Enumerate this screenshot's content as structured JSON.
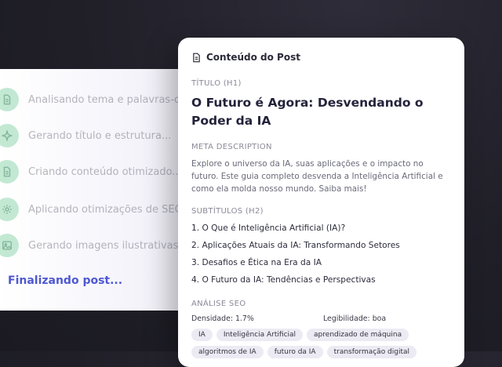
{
  "progress": {
    "steps": [
      {
        "label": "Analisando tema e palavras-chave...",
        "icon": "document-icon"
      },
      {
        "label": "Gerando título e estrutura...",
        "icon": "sparkle-icon"
      },
      {
        "label": "Criando conteúdo otimizado...",
        "icon": "document-icon"
      },
      {
        "label": "Aplicando otimizações de SEO...",
        "icon": "gear-icon"
      },
      {
        "label": "Gerando imagens ilustrativas...",
        "icon": "image-icon"
      }
    ],
    "current": "Finalizando post..."
  },
  "post": {
    "header": "Conteúdo do Post",
    "title_label": "TÍTULO (H1)",
    "title": "O Futuro é Agora: Desvendando o Poder da IA",
    "meta_label": "META DESCRIPTION",
    "meta": "Explore o universo da IA, suas aplicações e o impacto no futuro. Este guia completo desvenda a Inteligência Artificial e como ela molda nosso mundo. Saiba mais!",
    "subtitles_label": "SUBTÍTULOS (H2)",
    "subtitles": [
      "1. O Que é Inteligência Artificial (IA)?",
      "2. Aplicações Atuais da IA: Transformando Setores",
      "3. Desafios e Ética na Era da IA",
      "4. O Futuro da IA: Tendências e Perspectivas"
    ],
    "seo_label": "ANÁLISE SEO",
    "density": "Densidade: 1.7%",
    "readability": "Legibilidade: boa",
    "keywords": [
      "IA",
      "Inteligência Artificial",
      "aprendizado de máquina",
      "algoritmos de IA",
      "futuro da IA",
      "transformação digital"
    ]
  },
  "colors": {
    "accent": "#4e58d0",
    "step_icon_bg": "#9fdcb9"
  }
}
